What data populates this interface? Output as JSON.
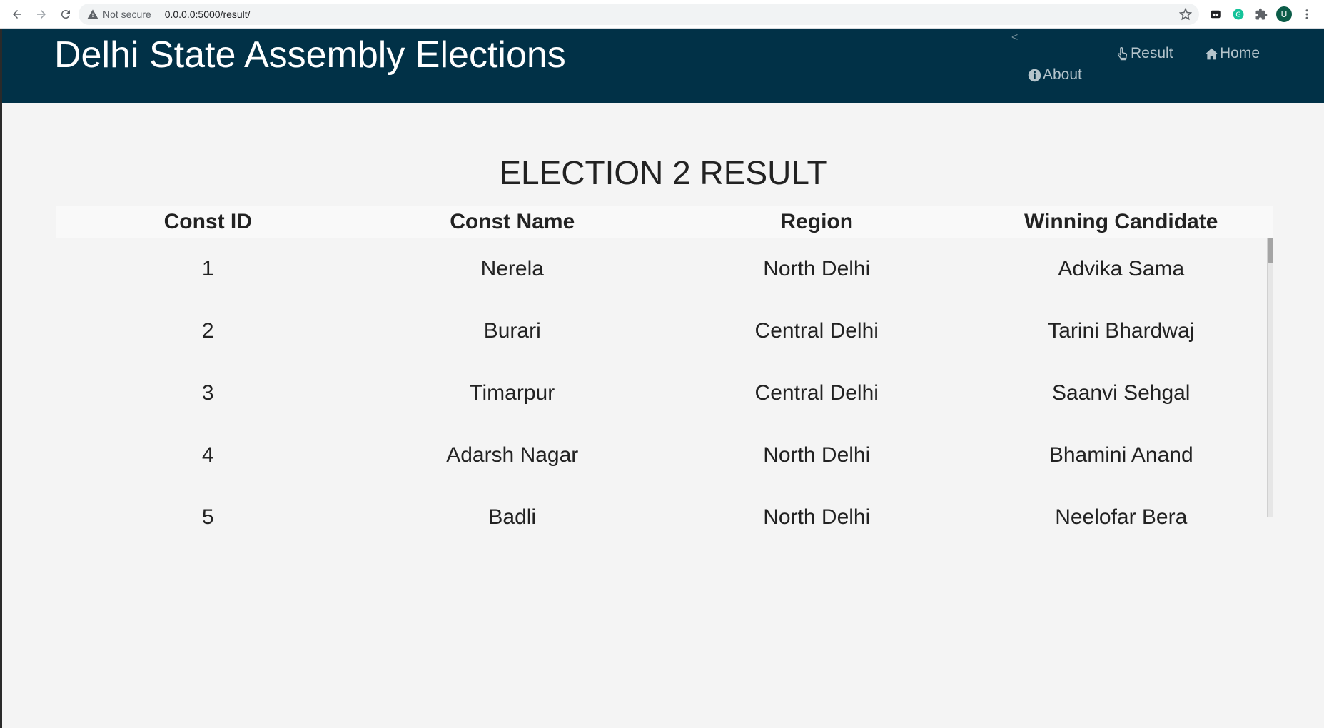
{
  "browser": {
    "security_label": "Not secure",
    "url": "0.0.0.0:5000/result/",
    "profile_initial": "U",
    "icons": [
      "back-arrow-icon",
      "forward-arrow-icon",
      "reload-icon",
      "warning-icon",
      "star-icon",
      "media-extension-icon",
      "grammarly-icon",
      "puzzle-extensions-icon",
      "profile-avatar",
      "kebab-menu-icon"
    ]
  },
  "header": {
    "title": "Delhi State Assembly Elections",
    "nav": {
      "home": "Home",
      "result": "Result",
      "about": "About",
      "arrow": "<"
    },
    "bg_color": "#013147"
  },
  "main": {
    "heading": "ELECTION 2 RESULT",
    "table": {
      "columns": [
        "Const ID",
        "Const Name",
        "Region",
        "Winning Candidate"
      ],
      "rows": [
        [
          "1",
          "Nerela",
          "North Delhi",
          "Advika Sama"
        ],
        [
          "2",
          "Burari",
          "Central Delhi",
          "Tarini Bhardwaj"
        ],
        [
          "3",
          "Timarpur",
          "Central Delhi",
          "Saanvi Sehgal"
        ],
        [
          "4",
          "Adarsh Nagar",
          "North Delhi",
          "Bhamini Anand"
        ],
        [
          "5",
          "Badli",
          "North Delhi",
          "Neelofar Bera"
        ]
      ]
    }
  }
}
